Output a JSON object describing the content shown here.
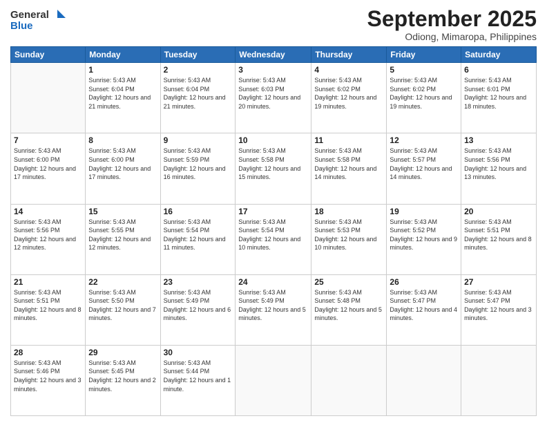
{
  "logo": {
    "general": "General",
    "blue": "Blue"
  },
  "header": {
    "month": "September 2025",
    "location": "Odiong, Mimaropa, Philippines"
  },
  "weekdays": [
    "Sunday",
    "Monday",
    "Tuesday",
    "Wednesday",
    "Thursday",
    "Friday",
    "Saturday"
  ],
  "weeks": [
    [
      {
        "day": "",
        "empty": true
      },
      {
        "day": "1",
        "sunrise": "5:43 AM",
        "sunset": "6:04 PM",
        "daylight": "12 hours and 21 minutes."
      },
      {
        "day": "2",
        "sunrise": "5:43 AM",
        "sunset": "6:04 PM",
        "daylight": "12 hours and 21 minutes."
      },
      {
        "day": "3",
        "sunrise": "5:43 AM",
        "sunset": "6:03 PM",
        "daylight": "12 hours and 20 minutes."
      },
      {
        "day": "4",
        "sunrise": "5:43 AM",
        "sunset": "6:02 PM",
        "daylight": "12 hours and 19 minutes."
      },
      {
        "day": "5",
        "sunrise": "5:43 AM",
        "sunset": "6:02 PM",
        "daylight": "12 hours and 19 minutes."
      },
      {
        "day": "6",
        "sunrise": "5:43 AM",
        "sunset": "6:01 PM",
        "daylight": "12 hours and 18 minutes."
      }
    ],
    [
      {
        "day": "7",
        "sunrise": "5:43 AM",
        "sunset": "6:00 PM",
        "daylight": "12 hours and 17 minutes."
      },
      {
        "day": "8",
        "sunrise": "5:43 AM",
        "sunset": "6:00 PM",
        "daylight": "12 hours and 17 minutes."
      },
      {
        "day": "9",
        "sunrise": "5:43 AM",
        "sunset": "5:59 PM",
        "daylight": "12 hours and 16 minutes."
      },
      {
        "day": "10",
        "sunrise": "5:43 AM",
        "sunset": "5:58 PM",
        "daylight": "12 hours and 15 minutes."
      },
      {
        "day": "11",
        "sunrise": "5:43 AM",
        "sunset": "5:58 PM",
        "daylight": "12 hours and 14 minutes."
      },
      {
        "day": "12",
        "sunrise": "5:43 AM",
        "sunset": "5:57 PM",
        "daylight": "12 hours and 14 minutes."
      },
      {
        "day": "13",
        "sunrise": "5:43 AM",
        "sunset": "5:56 PM",
        "daylight": "12 hours and 13 minutes."
      }
    ],
    [
      {
        "day": "14",
        "sunrise": "5:43 AM",
        "sunset": "5:56 PM",
        "daylight": "12 hours and 12 minutes."
      },
      {
        "day": "15",
        "sunrise": "5:43 AM",
        "sunset": "5:55 PM",
        "daylight": "12 hours and 12 minutes."
      },
      {
        "day": "16",
        "sunrise": "5:43 AM",
        "sunset": "5:54 PM",
        "daylight": "12 hours and 11 minutes."
      },
      {
        "day": "17",
        "sunrise": "5:43 AM",
        "sunset": "5:54 PM",
        "daylight": "12 hours and 10 minutes."
      },
      {
        "day": "18",
        "sunrise": "5:43 AM",
        "sunset": "5:53 PM",
        "daylight": "12 hours and 10 minutes."
      },
      {
        "day": "19",
        "sunrise": "5:43 AM",
        "sunset": "5:52 PM",
        "daylight": "12 hours and 9 minutes."
      },
      {
        "day": "20",
        "sunrise": "5:43 AM",
        "sunset": "5:51 PM",
        "daylight": "12 hours and 8 minutes."
      }
    ],
    [
      {
        "day": "21",
        "sunrise": "5:43 AM",
        "sunset": "5:51 PM",
        "daylight": "12 hours and 8 minutes."
      },
      {
        "day": "22",
        "sunrise": "5:43 AM",
        "sunset": "5:50 PM",
        "daylight": "12 hours and 7 minutes."
      },
      {
        "day": "23",
        "sunrise": "5:43 AM",
        "sunset": "5:49 PM",
        "daylight": "12 hours and 6 minutes."
      },
      {
        "day": "24",
        "sunrise": "5:43 AM",
        "sunset": "5:49 PM",
        "daylight": "12 hours and 5 minutes."
      },
      {
        "day": "25",
        "sunrise": "5:43 AM",
        "sunset": "5:48 PM",
        "daylight": "12 hours and 5 minutes."
      },
      {
        "day": "26",
        "sunrise": "5:43 AM",
        "sunset": "5:47 PM",
        "daylight": "12 hours and 4 minutes."
      },
      {
        "day": "27",
        "sunrise": "5:43 AM",
        "sunset": "5:47 PM",
        "daylight": "12 hours and 3 minutes."
      }
    ],
    [
      {
        "day": "28",
        "sunrise": "5:43 AM",
        "sunset": "5:46 PM",
        "daylight": "12 hours and 3 minutes."
      },
      {
        "day": "29",
        "sunrise": "5:43 AM",
        "sunset": "5:45 PM",
        "daylight": "12 hours and 2 minutes."
      },
      {
        "day": "30",
        "sunrise": "5:43 AM",
        "sunset": "5:44 PM",
        "daylight": "12 hours and 1 minute."
      },
      {
        "day": "",
        "empty": true
      },
      {
        "day": "",
        "empty": true
      },
      {
        "day": "",
        "empty": true
      },
      {
        "day": "",
        "empty": true
      }
    ]
  ]
}
